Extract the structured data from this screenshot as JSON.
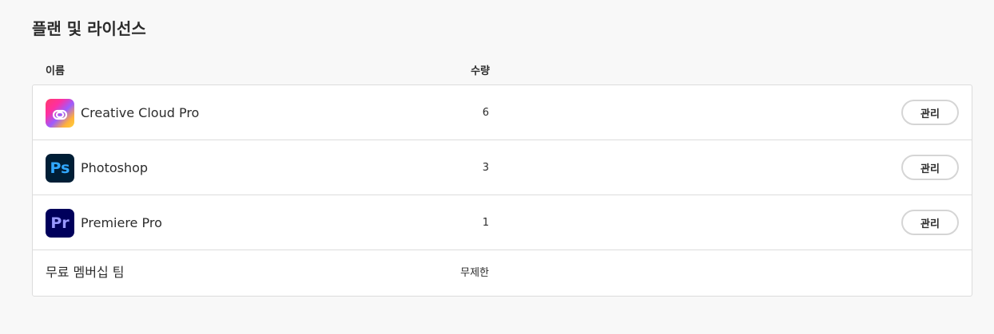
{
  "page": {
    "title": "플랜 및 라이선스"
  },
  "columns": {
    "name": "이름",
    "quantity": "수량"
  },
  "rows": [
    {
      "name": "Creative Cloud Pro",
      "quantity": "6",
      "action": "관리",
      "icon": "creative-cloud-icon"
    },
    {
      "name": "Photoshop",
      "quantity": "3",
      "action": "관리",
      "icon": "photoshop-icon",
      "icon_text": "Ps"
    },
    {
      "name": "Premiere Pro",
      "quantity": "1",
      "action": "관리",
      "icon": "premiere-pro-icon",
      "icon_text": "Pr"
    },
    {
      "name": "무료 멤버십 팀",
      "quantity": "무제한"
    }
  ],
  "colors": {
    "photoshop": "#001e36",
    "photoshop_text": "#31a8ff",
    "premiere": "#00005b",
    "premiere_text": "#9999ff"
  }
}
